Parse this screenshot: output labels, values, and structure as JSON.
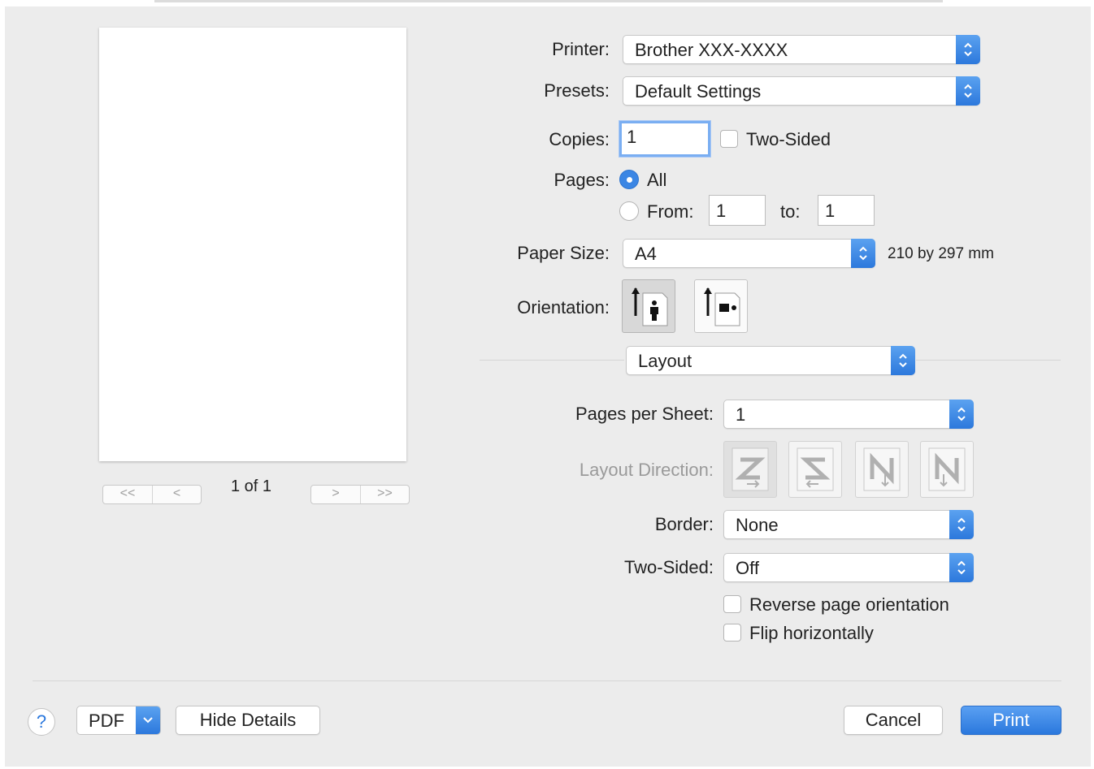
{
  "dialog": {
    "printer": {
      "label": "Printer:",
      "value": "Brother XXX-XXXX"
    },
    "presets": {
      "label": "Presets:",
      "value": "Default Settings"
    },
    "copies": {
      "label": "Copies:",
      "value": "1",
      "two_sided_label": "Two-Sided",
      "two_sided_checked": false
    },
    "pages": {
      "label": "Pages:",
      "all_label": "All",
      "from_label": "From:",
      "from_value": "1",
      "to_label": "to:",
      "to_value": "1",
      "selected": "All"
    },
    "paper_size": {
      "label": "Paper Size:",
      "value": "A4",
      "dimensions": "210 by 297 mm"
    },
    "orientation": {
      "label": "Orientation:",
      "selected": "portrait",
      "options": [
        "portrait",
        "landscape"
      ]
    },
    "section_popup": {
      "value": "Layout"
    },
    "layout": {
      "pages_per_sheet": {
        "label": "Pages per Sheet:",
        "value": "1"
      },
      "layout_direction": {
        "label": "Layout Direction:",
        "options": [
          "Z",
          "S",
          "И",
          "N"
        ],
        "enabled": false
      },
      "border": {
        "label": "Border:",
        "value": "None"
      },
      "two_sided": {
        "label": "Two-Sided:",
        "value": "Off"
      },
      "reverse_orientation": {
        "label": "Reverse page orientation",
        "checked": false
      },
      "flip_horizontally": {
        "label": "Flip horizontally",
        "checked": false
      }
    },
    "preview": {
      "page_indicator": "1 of 1",
      "nav_first": "<<",
      "nav_prev": "<",
      "nav_next": ">",
      "nav_last": ">>"
    },
    "footer": {
      "help_label": "?",
      "pdf_label": "PDF",
      "hide_details_label": "Hide Details",
      "cancel_label": "Cancel",
      "print_label": "Print"
    }
  },
  "colors": {
    "accent": "#2c78dc",
    "background": "#ececec"
  }
}
